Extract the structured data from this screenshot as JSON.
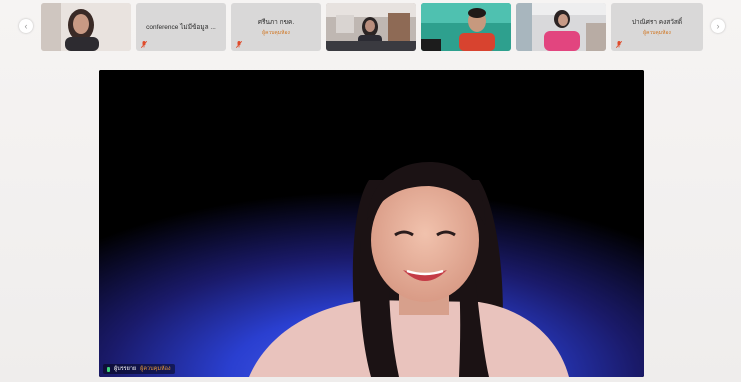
{
  "nav": {
    "prev_glyph": "‹",
    "next_glyph": "›"
  },
  "participants": [
    {
      "id": "p1",
      "name": "",
      "has_video": true
    },
    {
      "id": "p2",
      "name": "conference ไม่มีข้อมูล ...",
      "sub": "",
      "has_video": false,
      "muted": true
    },
    {
      "id": "p3",
      "name": "ศรีนภา กขค.",
      "sub": "ผู้ควบคุมห้อง",
      "has_video": false,
      "muted": true
    },
    {
      "id": "p4",
      "name": "",
      "has_video": true
    },
    {
      "id": "p5",
      "name": "",
      "has_video": true
    },
    {
      "id": "p6",
      "name": "",
      "has_video": true
    },
    {
      "id": "p7",
      "name": "ปาณิศรา คงสวัสดิ์",
      "sub": "ผู้ควบคุมห้อง",
      "has_video": false,
      "muted": true
    }
  ],
  "main_speaker": {
    "name": "ผู้บรรยาย",
    "role": "ผู้ควบคุมห้อง"
  },
  "colors": {
    "background": "#f3f2f1",
    "tile_bg": "#d9d8d8",
    "host_label": "#d0741e",
    "mute": "#e04a2a",
    "stage_bg": "#000000",
    "stage_glow": "#2a3fd0",
    "speaking": "#3fd17b"
  },
  "icons": {
    "prev": "chevron-left-icon",
    "next": "chevron-right-icon",
    "mute": "mic-off-icon",
    "mic": "mic-active-icon"
  }
}
